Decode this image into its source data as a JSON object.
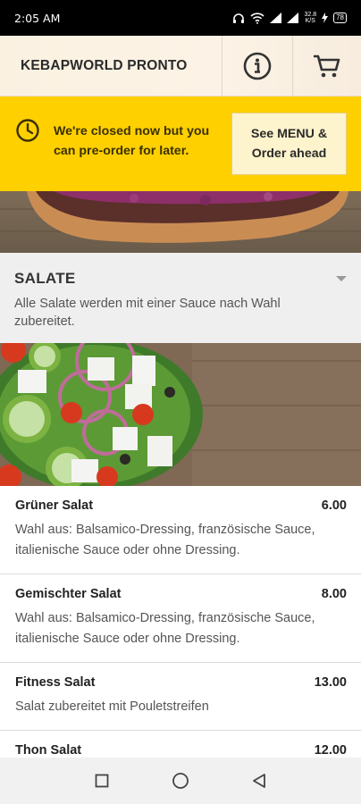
{
  "status_bar": {
    "time": "2:05 AM",
    "speed_top": "32.8",
    "speed_unit": "K/S",
    "battery": "78"
  },
  "header": {
    "title": "KEBAPWORLD PRONTO"
  },
  "notice": {
    "message": "We're closed now but you can pre-order for later.",
    "button_label": "See MENU & Order ahead"
  },
  "section": {
    "title": "SALATE",
    "description": "Alle Salate werden mit einer Sauce nach Wahl zubereitet."
  },
  "menu_items": [
    {
      "name": "Grüner Salat",
      "price": "6.00",
      "description": "Wahl aus: Balsamico-Dressing, französische Sauce, italienische Sauce oder ohne Dressing."
    },
    {
      "name": "Gemischter Salat",
      "price": "8.00",
      "description": "Wahl aus: Balsamico-Dressing, französische Sauce, italienische Sauce oder ohne Dressing."
    },
    {
      "name": "Fitness Salat",
      "price": "13.00",
      "description": "Salat zubereitet mit Pouletstreifen"
    },
    {
      "name": "Thon Salat",
      "price": "12.00",
      "description": ""
    }
  ],
  "icons": {
    "info": "info-circle-icon",
    "cart": "shopping-cart-icon",
    "clock": "clock-icon",
    "nav_recents": "square-icon",
    "nav_home": "circle-icon",
    "nav_back": "triangle-back-icon"
  },
  "colors": {
    "notice_bg": "#ffd000",
    "notice_button_bg": "#fdf3cc",
    "header_bg": "#fbf1e1",
    "section_bg": "#efefef"
  }
}
